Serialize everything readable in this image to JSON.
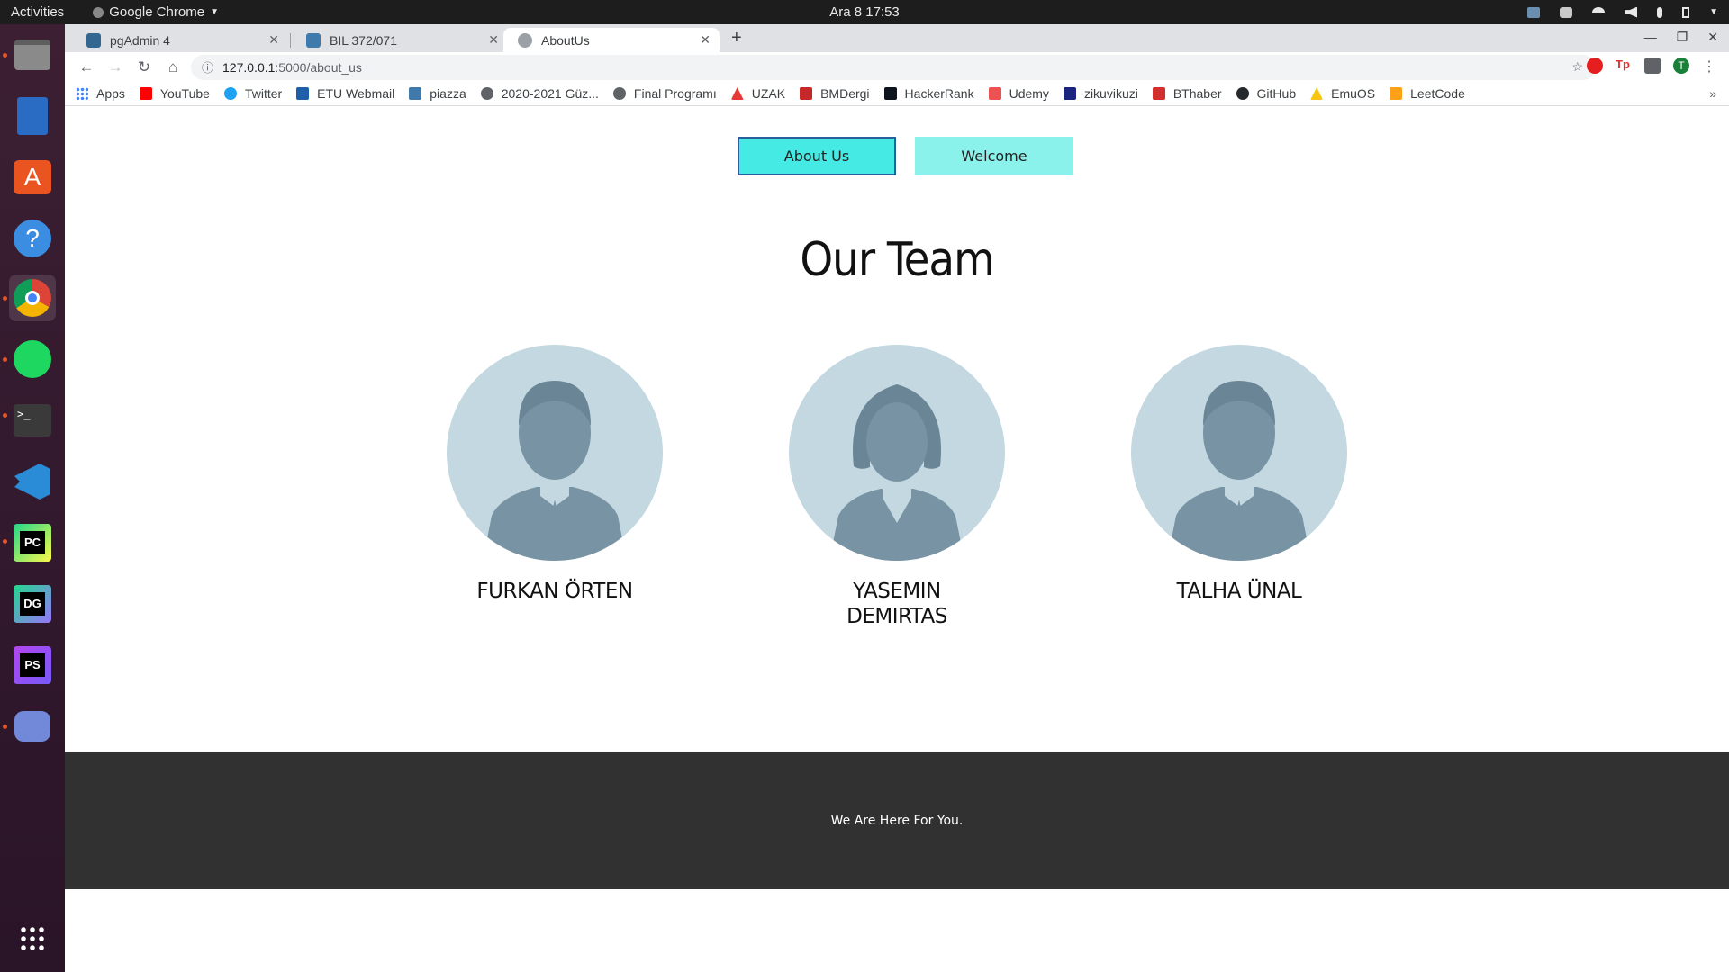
{
  "os": {
    "activities": "Activities",
    "app_name": "Google Chrome",
    "clock": "Ara 8  17:53"
  },
  "browser": {
    "tabs": [
      {
        "title": "pgAdmin 4",
        "favicon": "pgadmin-icon"
      },
      {
        "title": "BIL 372/071",
        "favicon": "piazza-icon"
      },
      {
        "title": "AboutUs",
        "favicon": "globe-icon"
      }
    ],
    "url_host": "127.0.0.1",
    "url_path": ":5000/about_us",
    "bookmarks": [
      {
        "label": "Apps"
      },
      {
        "label": "YouTube"
      },
      {
        "label": "Twitter"
      },
      {
        "label": "ETU Webmail"
      },
      {
        "label": "piazza"
      },
      {
        "label": "2020-2021 Güz..."
      },
      {
        "label": "Final Programı"
      },
      {
        "label": "UZAK"
      },
      {
        "label": "BMDergi"
      },
      {
        "label": "HackerRank"
      },
      {
        "label": "Udemy"
      },
      {
        "label": "zikuvikuzi"
      },
      {
        "label": "BThaber"
      },
      {
        "label": "GitHub"
      },
      {
        "label": "EmuOS"
      },
      {
        "label": "LeetCode"
      }
    ],
    "profile_initial": "T"
  },
  "page": {
    "nav": {
      "about_label": "About Us",
      "welcome_label": "Welcome"
    },
    "title": "Our Team",
    "members": [
      {
        "name": "FURKAN ÖRTEN",
        "avatar": "male"
      },
      {
        "name": "YASEMIN DEMIRTAS",
        "avatar": "female"
      },
      {
        "name": "TALHA ÜNAL",
        "avatar": "male"
      }
    ],
    "footer_text": "We Are Here For You."
  },
  "colors": {
    "about_button": "#44eae3",
    "welcome_button": "#8af2ea",
    "footer_bg": "#313131",
    "avatar_bg": "#c3d8e0",
    "avatar_figure": "#7893a3"
  }
}
